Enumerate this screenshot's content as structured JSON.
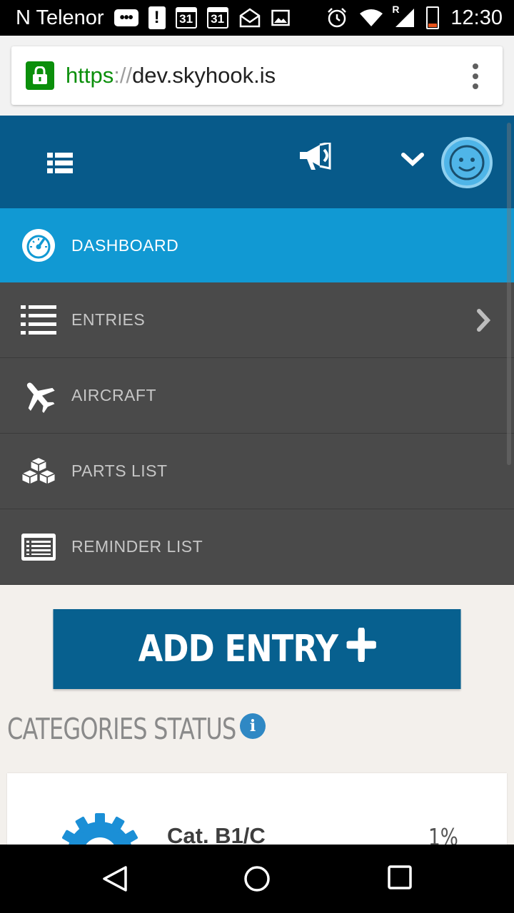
{
  "status_bar": {
    "carrier": "N Telenor",
    "time": "12:30",
    "icons": [
      "chat-bubble-icon",
      "alert-icon",
      "calendar-icon",
      "calendar-icon",
      "mail-notification-icon",
      "image-icon",
      "alarm-icon",
      "wifi-icon",
      "signal-icon",
      "battery-icon"
    ],
    "calendar_day_1": "31",
    "calendar_day_2": "31",
    "alert_glyph": "!",
    "chat_glyph": "•••",
    "roaming_glyph": "R"
  },
  "browser": {
    "url_scheme": "https",
    "url_separator": "://",
    "url_host": "dev.skyhook.is",
    "menu_icon": "overflow-menu-icon"
  },
  "header": {
    "menu_icon": "list-menu-icon",
    "announcements_icon": "megaphone-icon",
    "dropdown_icon": "chevron-down-icon",
    "avatar_icon": "user-avatar-icon",
    "background": "#075a8a"
  },
  "nav": {
    "items": [
      {
        "label": "DASHBOARD",
        "icon": "dashboard-gauge-icon",
        "active": true
      },
      {
        "label": "ENTRIES",
        "icon": "list-icon",
        "active": false,
        "has_submenu": true
      },
      {
        "label": "AIRCRAFT",
        "icon": "airplane-icon",
        "active": false
      },
      {
        "label": "PARTS LIST",
        "icon": "cubes-icon",
        "active": false
      },
      {
        "label": "REMINDER LIST",
        "icon": "reminder-list-icon",
        "active": false
      }
    ],
    "active_color": "#1199d3",
    "item_color": "#4a4a4a"
  },
  "main": {
    "add_entry_label": "ADD ENTRY",
    "add_entry_icon": "plus-icon",
    "section_title": "CATEGORIES STATUS",
    "info_glyph": "i",
    "categories": [
      {
        "label": "Cat. B1/C",
        "percent": "1%",
        "icon": "gear-icon"
      }
    ]
  },
  "system_nav": {
    "icons": [
      "back-icon",
      "home-icon",
      "recents-icon"
    ]
  }
}
